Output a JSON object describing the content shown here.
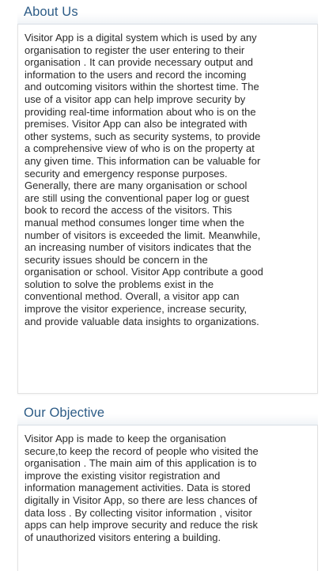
{
  "about": {
    "heading": "About Us",
    "lines": [
      "Visitor App is a digital system which is used by any",
      "organisation to register the user entering to their",
      "organisation . It can provide necessary output and",
      "information to the users and record the incoming",
      "and outcoming visitors within the shortest time. The",
      "use of a visitor app can help improve security by",
      "providing real-time information about who is on the",
      "premises. Visitor App can also be integrated with",
      "other systems, such as security systems, to provide",
      "a comprehensive view of who is on the property at",
      "any given time. This information can be valuable for",
      "security and emergency response purposes.",
      "Generally, there are many organisation or school",
      "are still using the conventional paper log or guest",
      "book to record the access of the visitors. This",
      "manual method consumes longer time when the",
      "number of visitors is exceeded the limit. Meanwhile,",
      "an increasing number of visitors indicates that the",
      "security issues should be concern in the",
      "organisation or school. Visitor App contribute a good",
      "solution to solve the problems exist in the",
      "conventional method. Overall, a visitor app can",
      "improve the visitor experience, increase security,",
      "and provide valuable data insights to organizations."
    ]
  },
  "objective": {
    "heading": "Our Objective",
    "lines": [
      "Visitor App is made to keep the organisation",
      "secure,to keep the record of people who visited the",
      "organisation . The main aim of this application is to",
      "improve the existing visitor registration and",
      "information management activities. Data is stored",
      "digitally in Visitor App, so there are less chances of",
      "data loss . By collecting visitor information , visitor",
      "apps can help improve security and reduce the risk",
      "of unauthorized visitors entering a building."
    ]
  }
}
